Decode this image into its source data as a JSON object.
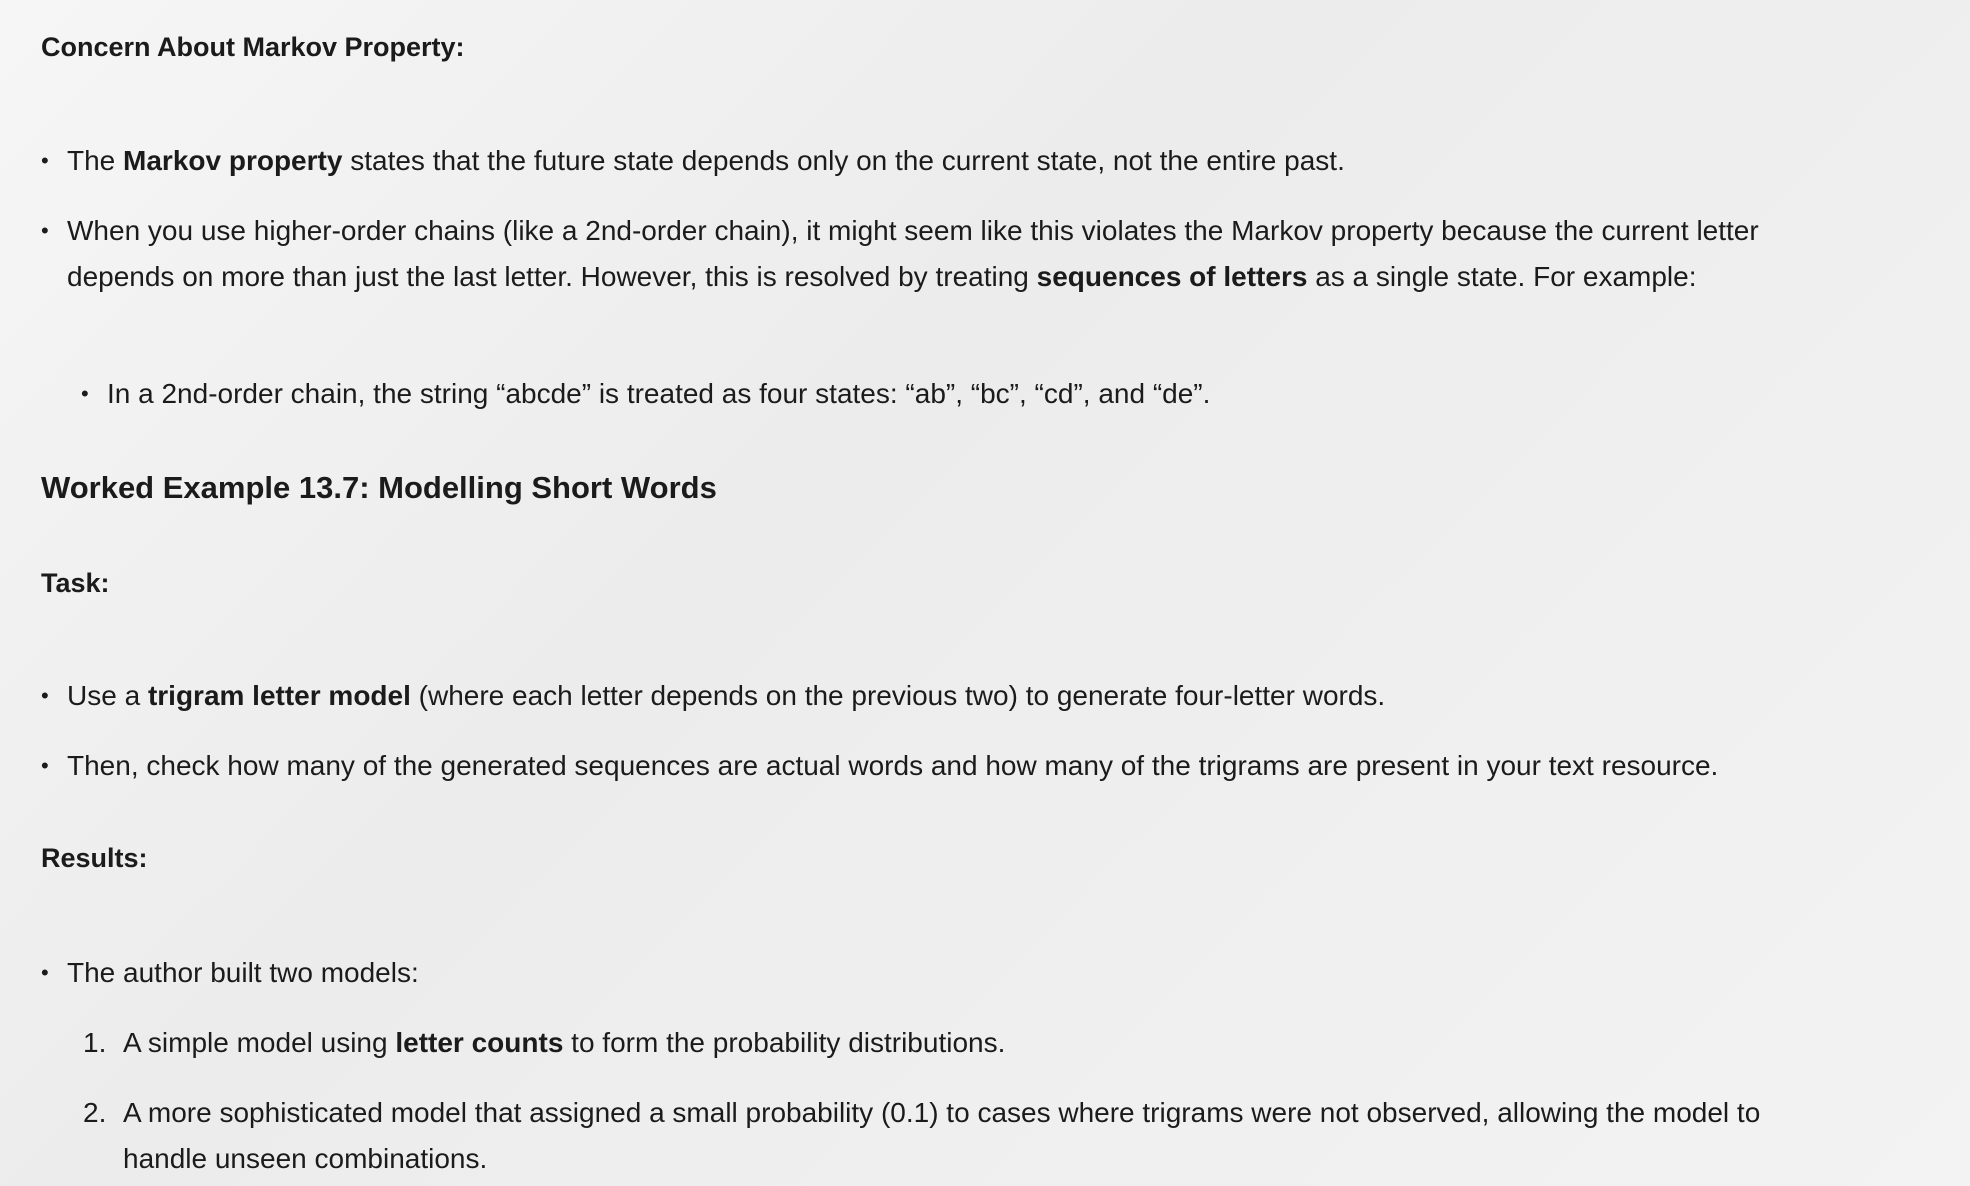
{
  "section1": {
    "heading": "Concern About Markov Property:",
    "bullet1": {
      "pre": "The ",
      "bold": "Markov property",
      "post": " states that the future state depends only on the current state, not the entire past."
    },
    "bullet2": {
      "pre": "When you use higher-order chains (like a 2nd-order chain), it might seem like this violates the Markov property because the current letter depends on more than just the last letter. However, this is resolved by treating ",
      "bold": "sequences of letters",
      "post": " as a single state. For example:"
    },
    "subbullet": "In a 2nd-order chain, the string “abcde” is treated as four states: “ab”, “bc”, “cd”, and “de”."
  },
  "worked_example": {
    "title": "Worked Example 13.7: Modelling Short Words"
  },
  "task": {
    "heading": "Task:",
    "bullet1": {
      "pre": "Use a ",
      "bold": "trigram letter model",
      "post": " (where each letter depends on the previous two) to generate four-letter words."
    },
    "bullet2": "Then, check how many of the generated sequences are actual words and how many of the trigrams are present in your text resource."
  },
  "results": {
    "heading": "Results:",
    "bullet1": "The author built two models:",
    "item1": {
      "marker": "1.",
      "pre": "A simple model using ",
      "bold": "letter counts",
      "post": " to form the probability distributions."
    },
    "item2": {
      "marker": "2.",
      "text": "A more sophisticated model that assigned a small probability (0.1) to cases where trigrams were not observed, allowing the model to handle unseen combinations."
    }
  }
}
